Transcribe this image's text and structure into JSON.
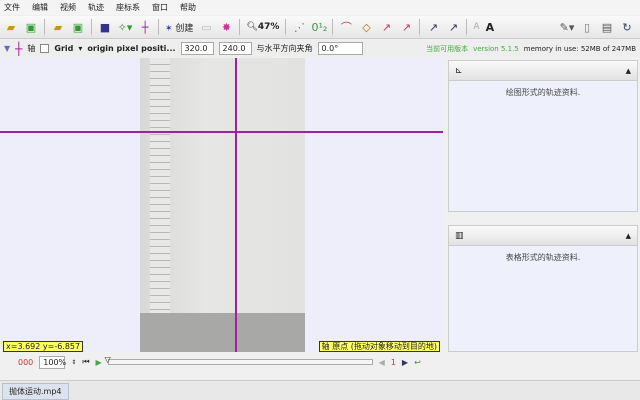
{
  "menu": [
    "文件",
    "编辑",
    "视频",
    "轨迹",
    "座标系",
    "窗口",
    "帮助"
  ],
  "toolbar": {
    "create_label": "创建",
    "zoom_label": "47%",
    "font_smaller": "A",
    "font_larger": "A"
  },
  "axes_bar": {
    "axis_label": "轴",
    "grid_label": "Grid",
    "origin_label": "origin pixel positi...",
    "origin_x": "320.0",
    "origin_y": "240.0",
    "angle_label": "与水平方向夹角",
    "angle_value": "0.0°",
    "update_label": "当前可用版本",
    "version": "version 5.1.5",
    "memory": "memory in use: 52MB of 247MB"
  },
  "video": {
    "coords": "x=3.692  y=-6.857",
    "hint": "轴 原点 (拖动对象移动到目的地)"
  },
  "player": {
    "frame": "000",
    "rate": "100%",
    "step": "1"
  },
  "panels": {
    "plot_text": "绘图形式的轨迹资料.",
    "table_text": "表格形式的轨迹资料."
  },
  "tabs": [
    "抛体运动.mp4"
  ],
  "colors": {
    "axis": "#a020a0",
    "label_bg": "#ffff66",
    "version": "#44aa44"
  }
}
